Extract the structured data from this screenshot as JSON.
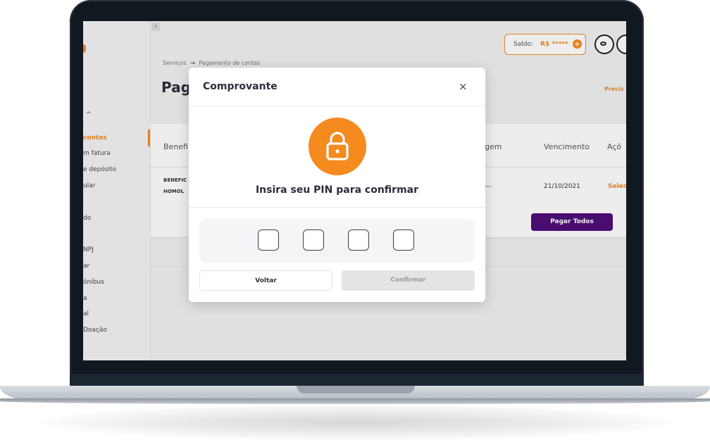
{
  "sidebar": {
    "items": [
      {
        "label": "contas",
        "active": true
      },
      {
        "label": "m fatura"
      },
      {
        "label": "e depósito"
      },
      {
        "label": "ular"
      },
      {
        "label": "do"
      },
      {
        "label": "NPJ"
      },
      {
        "label": "ar"
      },
      {
        "label": "ônibus"
      },
      {
        "label": "a"
      },
      {
        "label": "al"
      },
      {
        "label": "Doação"
      }
    ],
    "collapse_icon": "chevron-left-icon",
    "group_caret": "^"
  },
  "header": {
    "saldo_label": "Saldo:",
    "saldo_value": "R$ *****",
    "saldo_add": "+",
    "eye_icon": "eye-icon",
    "fullscreen_icon": "fullscreen-icon"
  },
  "breadcrumb": {
    "parent": "Serviços",
    "arrow": "→",
    "current": "Pagamento de contas"
  },
  "page": {
    "title": "Pag",
    "help": "Precis"
  },
  "table": {
    "headers": [
      "Benefi",
      "gem",
      "Vencimento",
      "Açõ"
    ],
    "row": {
      "beneficiary_line1": "BENEFIC",
      "beneficiary_line2": "HOMOL",
      "origin": "---",
      "due_date": "21/10/2021",
      "action": "Selec"
    },
    "pay_all_label": "Pagar Todos"
  },
  "modal": {
    "title": "Comprovante",
    "close": "×",
    "lock_icon": "lock-icon",
    "prompt": "Insira seu PIN para confirmar",
    "pin_digits": [
      "",
      "",
      "",
      ""
    ],
    "back_label": "Voltar",
    "confirm_label": "Confirmar"
  },
  "colors": {
    "accent": "#f58a1f",
    "primary": "#4f0e7a",
    "disabled_bg": "#e4e4e7",
    "text_dark": "#2b2e3b"
  }
}
